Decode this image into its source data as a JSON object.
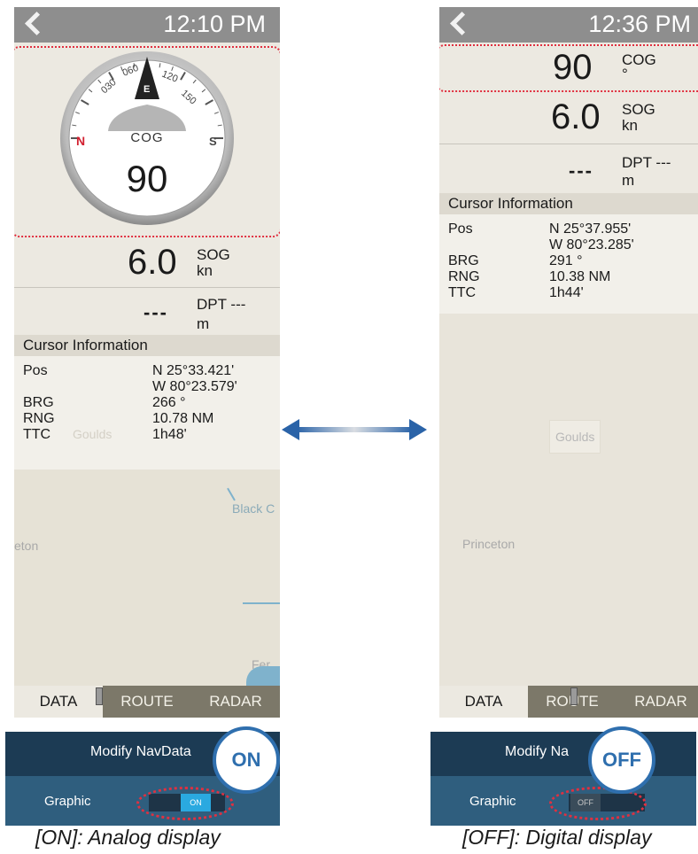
{
  "left": {
    "time": "12:10 PM",
    "gauge": {
      "ticks": [
        "030",
        "060",
        "120",
        "150"
      ],
      "north": "N",
      "east": "E",
      "south": "S",
      "label": "COG",
      "value": "90",
      "dial_ticks_deg": [
        30,
        60,
        120,
        150,
        0,
        180
      ]
    },
    "sog": {
      "value": "6.0",
      "label": "SOG",
      "unit": "kn"
    },
    "dpt": {
      "value": "---",
      "label": "DPT ---",
      "unit": "m"
    },
    "cursor": {
      "title": "Cursor Information",
      "rows": [
        {
          "label": "Pos",
          "value": "N 25°33.421'"
        },
        {
          "label": "",
          "value": "W 80°23.579'"
        },
        {
          "label": "BRG",
          "value": "266 °"
        },
        {
          "label": "RNG",
          "value": "10.78 NM"
        },
        {
          "label": "TTC",
          "value": "1h48'"
        }
      ]
    },
    "map": {
      "labels": [
        "Goulds",
        "eton",
        "Black C",
        "Fer"
      ]
    },
    "tabs": [
      "DATA",
      "ROUTE",
      "RADAR"
    ],
    "strip": {
      "title": "Modify NavData",
      "graphic_label": "Graphic",
      "toggle": "ON",
      "callout": "ON"
    },
    "caption": "[ON]: Analog display"
  },
  "right": {
    "time": "12:36 PM",
    "cog": {
      "value": "90",
      "label": "COG",
      "unit": "°"
    },
    "sog": {
      "value": "6.0",
      "label": "SOG",
      "unit": "kn"
    },
    "dpt": {
      "value": "---",
      "label": "DPT ---",
      "unit": "m"
    },
    "cursor": {
      "title": "Cursor Information",
      "rows": [
        {
          "label": "Pos",
          "value": "N 25°37.955'"
        },
        {
          "label": "",
          "value": "W 80°23.285'"
        },
        {
          "label": "BRG",
          "value": "291 °"
        },
        {
          "label": "RNG",
          "value": "10.38 NM"
        },
        {
          "label": "TTC",
          "value": "1h44'"
        }
      ]
    },
    "map": {
      "labels": [
        "Goulds",
        "Princeton"
      ]
    },
    "tabs": [
      "DATA",
      "ROUTE",
      "RADAR"
    ],
    "strip": {
      "title": "Modify Na",
      "graphic_label": "Graphic",
      "toggle": "OFF",
      "callout": "OFF"
    },
    "caption": "[OFF]: Digital display"
  },
  "colors": {
    "accent": "#2f6fae",
    "highlight": "#e03040",
    "header": "#8e8e8e",
    "tab_active": "#7c7869"
  }
}
